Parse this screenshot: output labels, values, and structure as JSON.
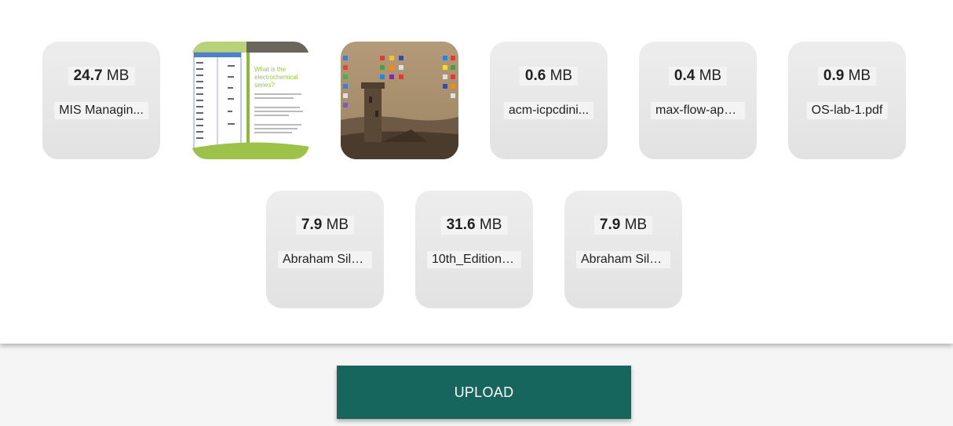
{
  "files": [
    {
      "type": "doc",
      "size_value": "24.7",
      "size_unit": "MB",
      "name": "MIS Managin..."
    },
    {
      "type": "image",
      "image": "chemistry-slide-thumbnail"
    },
    {
      "type": "image",
      "image": "desktop-castle-thumbnail"
    },
    {
      "type": "doc",
      "size_value": "0.6",
      "size_unit": "MB",
      "name": "acm-icpcdini..."
    },
    {
      "type": "doc",
      "size_value": "0.4",
      "size_unit": "MB",
      "name": "max-flow-app..."
    },
    {
      "type": "doc",
      "size_value": "0.9",
      "size_unit": "MB",
      "name": "OS-lab-1.pdf"
    },
    {
      "type": "doc",
      "size_value": "7.9",
      "size_unit": "MB",
      "name": "Abraham Silb..."
    },
    {
      "type": "doc",
      "size_value": "31.6",
      "size_unit": "MB",
      "name": "10th_Edition_..."
    },
    {
      "type": "doc",
      "size_value": "7.9",
      "size_unit": "MB",
      "name": "Abraham Silb..."
    }
  ],
  "upload": {
    "label": "UPLOAD"
  },
  "colors": {
    "upload_button": "#17665e",
    "panel": "#ffffff",
    "footer": "#f5f5f5",
    "tile": "#e8e8e8"
  }
}
